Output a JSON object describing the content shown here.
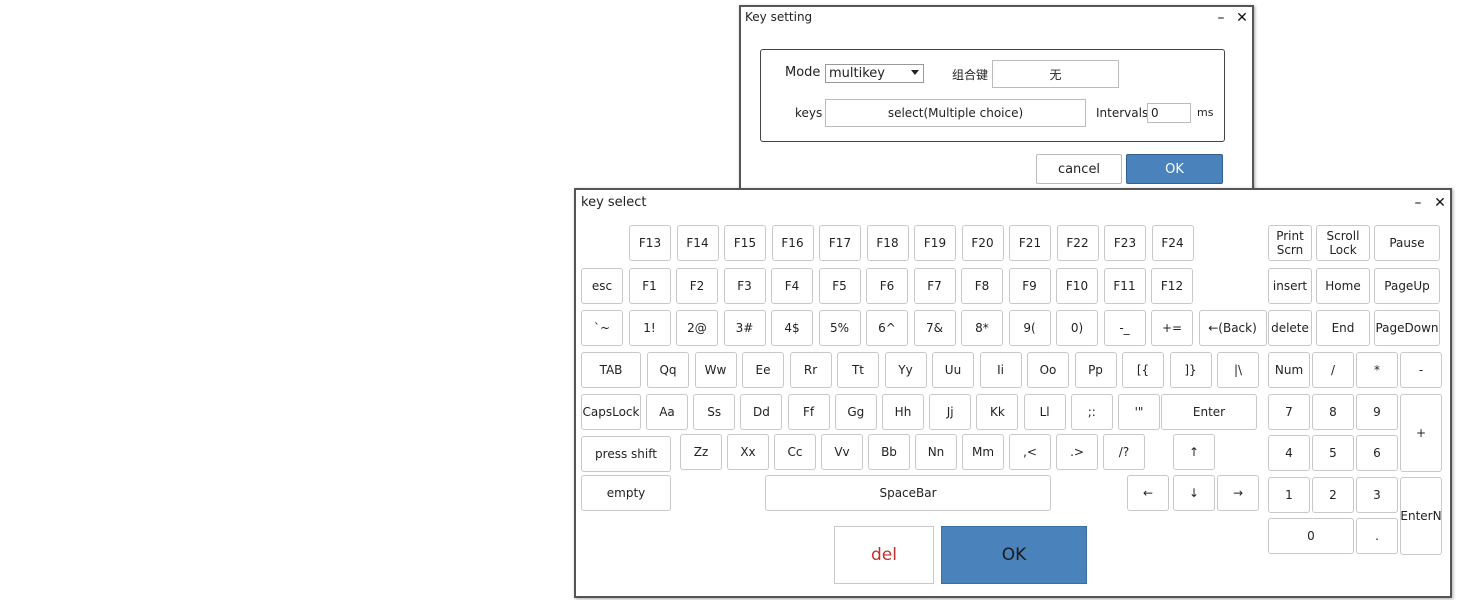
{
  "key_setting": {
    "title": "Key setting",
    "mode_label": "Mode",
    "mode_value": "multikey",
    "combo_label": "组合键",
    "combo_value": "无",
    "keys_label": "keys",
    "keys_value": "select(Multiple choice)",
    "intervals_label": "Intervals",
    "intervals_value": "0",
    "intervals_unit": "ms",
    "cancel_label": "cancel",
    "ok_label": "OK"
  },
  "key_select": {
    "title": "key select",
    "del_label": "del",
    "ok_label": "OK",
    "fn_top": [
      "F13",
      "F14",
      "F15",
      "F16",
      "F17",
      "F18",
      "F19",
      "F20",
      "F21",
      "F22",
      "F23",
      "F24"
    ],
    "fn_row": [
      "esc",
      "F1",
      "F2",
      "F3",
      "F4",
      "F5",
      "F6",
      "F7",
      "F8",
      "F9",
      "F10",
      "F11",
      "F12"
    ],
    "num_row": [
      "`~",
      "1!",
      "2@",
      "3#",
      "4$",
      "5%",
      "6^",
      "7&",
      "8*",
      "9(",
      "0)",
      "-_",
      "+=",
      "←(Back)"
    ],
    "q_row": [
      "TAB",
      "Qq",
      "Ww",
      "Ee",
      "Rr",
      "Tt",
      "Yy",
      "Uu",
      "Ii",
      "Oo",
      "Pp",
      "[{",
      "]}",
      "|\\"
    ],
    "a_row": [
      "CapsLock",
      "Aa",
      "Ss",
      "Dd",
      "Ff",
      "Gg",
      "Hh",
      "Jj",
      "Kk",
      "Ll",
      ";:",
      "'\"",
      "Enter"
    ],
    "z_row": [
      "press shift",
      "Zz",
      "Xx",
      "Cc",
      "Vv",
      "Bb",
      "Nn",
      "Mm",
      ",<",
      ".>",
      "/?",
      "↑"
    ],
    "bottom_row": [
      "empty",
      "SpaceBar",
      "←",
      "↓",
      "→"
    ],
    "nav": [
      "Print\nScrn",
      "Scroll\nLock",
      "Pause",
      "insert",
      "Home",
      "PageUp",
      "delete",
      "End",
      "PageDown"
    ],
    "numpad": [
      "Num",
      "/",
      "*",
      "-",
      "7",
      "8",
      "9",
      "+",
      "4",
      "5",
      "6",
      "1",
      "2",
      "3",
      "EnterN",
      "0",
      "."
    ]
  }
}
